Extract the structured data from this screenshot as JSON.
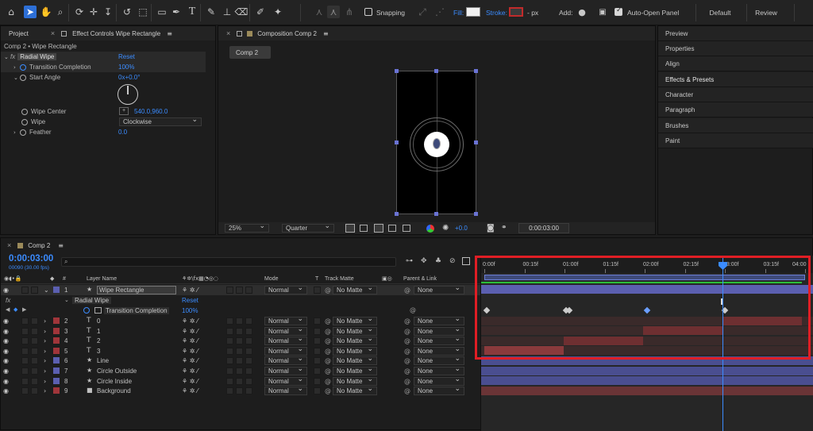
{
  "toolbar": {
    "snapping_label": "Snapping",
    "fill_label": "Fill:",
    "stroke_label": "Stroke:",
    "stroke_px": "- px",
    "add_label": "Add:",
    "auto_open_label": "Auto-Open Panel",
    "workspaces": [
      "Default",
      "Review"
    ]
  },
  "left_panel": {
    "tab_project": "Project",
    "tab_effect": "Effect Controls Wipe Rectangle",
    "breadcrumb": "Comp 2 • Wipe Rectangle",
    "effect_name": "Radial Wipe",
    "reset_label": "Reset",
    "props": [
      {
        "label": "Transition Completion",
        "value": "100%"
      },
      {
        "label": "Start Angle",
        "value": "0x+0.0°"
      },
      {
        "label": "Wipe Center",
        "value": "540.0,960.0"
      },
      {
        "label": "Wipe",
        "value": "Clockwise"
      },
      {
        "label": "Feather",
        "value": "0.0"
      }
    ]
  },
  "composition": {
    "tab": "Composition Comp 2",
    "chip": "Comp 2",
    "zoom": "25%",
    "resolution": "Quarter",
    "exposure": "+0.0",
    "timecode": "0:00:03:00"
  },
  "right_panel": {
    "items": [
      "Preview",
      "Properties",
      "Align",
      "Effects & Presets",
      "Character",
      "Paragraph",
      "Brushes",
      "Paint"
    ]
  },
  "timeline": {
    "tab": "Comp 2",
    "current_time": "0:00:03:00",
    "frame_info": "00090 (30.00 fps)",
    "search_placeholder": "",
    "col_layer_name": "Layer Name",
    "col_mode": "Mode",
    "col_t": "T",
    "col_track_matte": "Track Matte",
    "col_parent": "Parent & Link",
    "ruler": [
      "0:00f",
      "00:15f",
      "01:00f",
      "01:15f",
      "02:00f",
      "02:15f",
      "03:00f",
      "03:15f",
      "04:00"
    ],
    "playhead_fraction": 0.75,
    "effect_row": {
      "name": "Radial Wipe",
      "reset": "Reset"
    },
    "prop_row": {
      "name": "Transition Completion",
      "value": "100%"
    },
    "layers": [
      {
        "num": "1",
        "type": "star",
        "name": "Wipe Rectangle",
        "mode": "Normal",
        "matte": "No Matte",
        "parent": "None",
        "color": "#5b5fb0"
      },
      {
        "num": "2",
        "type": "T",
        "name": "0",
        "mode": "Normal",
        "matte": "No Matte",
        "parent": "None",
        "color": "#a0353a"
      },
      {
        "num": "3",
        "type": "T",
        "name": "1",
        "mode": "Normal",
        "matte": "No Matte",
        "parent": "None",
        "color": "#a0353a"
      },
      {
        "num": "4",
        "type": "T",
        "name": "2",
        "mode": "Normal",
        "matte": "No Matte",
        "parent": "None",
        "color": "#a0353a"
      },
      {
        "num": "5",
        "type": "T",
        "name": "3",
        "mode": "Normal",
        "matte": "No Matte",
        "parent": "None",
        "color": "#a0353a"
      },
      {
        "num": "6",
        "type": "star",
        "name": "Line",
        "mode": "Normal",
        "matte": "No Matte",
        "parent": "None",
        "color": "#5b5fb0"
      },
      {
        "num": "7",
        "type": "star",
        "name": "Circle Outside",
        "mode": "Normal",
        "matte": "No Matte",
        "parent": "None",
        "color": "#5b5fb0"
      },
      {
        "num": "8",
        "type": "star",
        "name": "Circle Inside",
        "mode": "Normal",
        "matte": "No Matte",
        "parent": "None",
        "color": "#5b5fb0"
      },
      {
        "num": "9",
        "type": "solid",
        "name": "Background",
        "mode": "Normal",
        "matte": "No Matte",
        "parent": "None",
        "color": "#a0353a"
      }
    ]
  },
  "colors": {
    "accent_blue": "#3b8cff",
    "highlight_red": "#e01e25",
    "label_purple": "#5b5fb0",
    "label_red": "#a0353a"
  }
}
